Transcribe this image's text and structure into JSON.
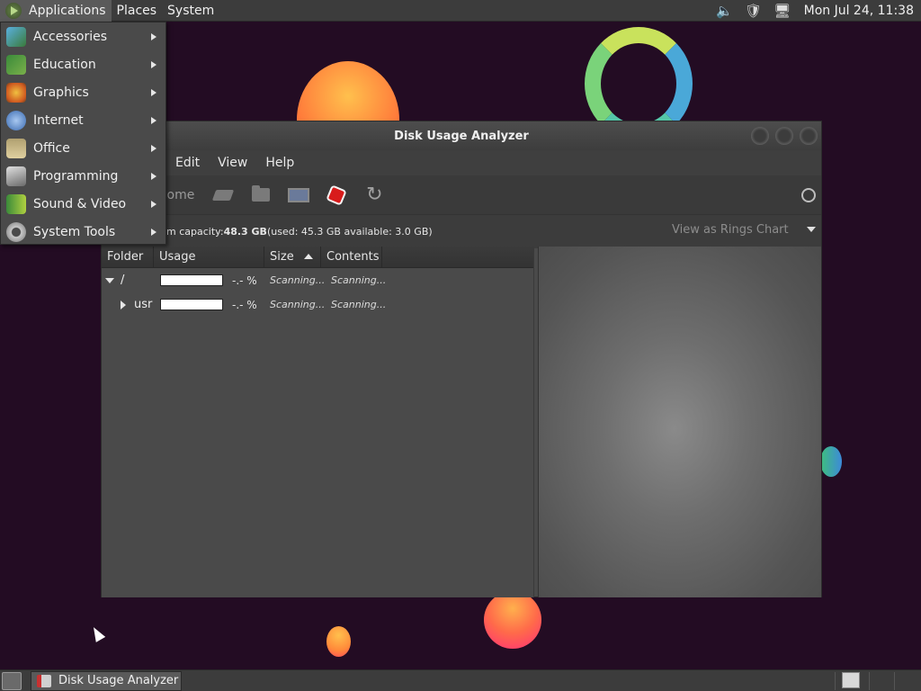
{
  "top_panel": {
    "menus": [
      "Applications",
      "Places",
      "System"
    ],
    "clock": "Mon Jul 24, 11:38",
    "tray_icons": [
      "volume-icon",
      "shield-icon",
      "network-icon"
    ]
  },
  "apps_dropdown": {
    "items": [
      {
        "label": "Accessories",
        "icon": "accessories-icon"
      },
      {
        "label": "Education",
        "icon": "education-icon"
      },
      {
        "label": "Graphics",
        "icon": "graphics-icon"
      },
      {
        "label": "Internet",
        "icon": "internet-icon"
      },
      {
        "label": "Office",
        "icon": "office-icon"
      },
      {
        "label": "Programming",
        "icon": "programming-icon"
      },
      {
        "label": "Sound & Video",
        "icon": "sound-video-icon"
      },
      {
        "label": "System Tools",
        "icon": "system-tools-icon"
      }
    ]
  },
  "window": {
    "title": "Disk Usage Analyzer",
    "menu": [
      "Edit",
      "View",
      "Help"
    ],
    "toolbar": {
      "home_label": "Home",
      "icons": [
        "drive-icon",
        "folder-icon",
        "network-icon",
        "stop-icon",
        "reload-icon",
        "gear-icon"
      ]
    },
    "info": {
      "prefix": "m capacity: ",
      "capacity": "48.3 GB",
      "details": " (used: 45.3 GB available: 3.0 GB)"
    },
    "view_select": "View as Rings Chart",
    "columns": [
      "Folder",
      "Usage",
      "Size",
      "Contents"
    ],
    "rows": [
      {
        "name": "/",
        "pct": "-.- %",
        "size": "Scanning...",
        "contents": "Scanning..."
      },
      {
        "name": "usr",
        "pct": "-.- %",
        "size": "Scanning...",
        "contents": "Scanning..."
      }
    ]
  },
  "taskbar": {
    "task": "Disk Usage Analyzer"
  },
  "colors": {
    "desktop": "#230c23",
    "panel": "#3c3c3c",
    "stop": "#d81b1b"
  }
}
